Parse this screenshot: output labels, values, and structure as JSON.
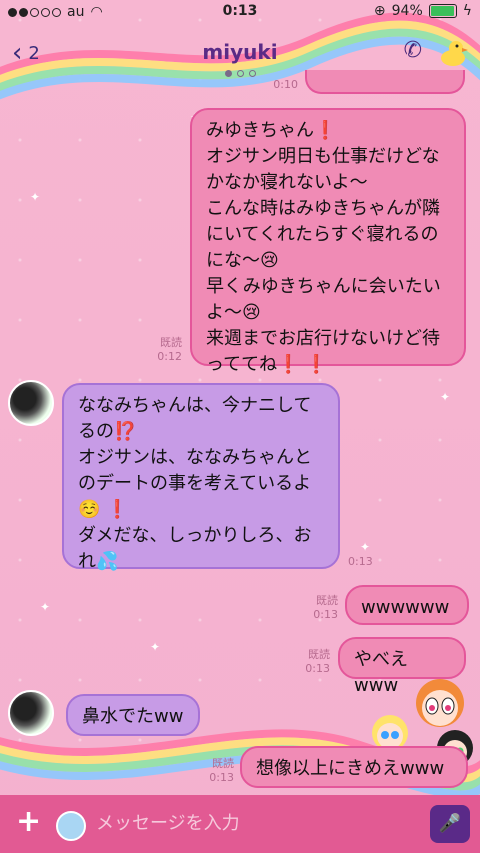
{
  "status_bar": {
    "carrier": "au",
    "time": "0:13",
    "battery": "94%"
  },
  "header": {
    "unread_count": "2",
    "title": "miyuki"
  },
  "messages": [
    {
      "id": "m0",
      "sender": "me",
      "time": "0:10"
    },
    {
      "id": "m1",
      "sender": "me",
      "text": "みゆきちゃん❗\nオジサン明日も仕事だけどな\nかなか寝れないよ〜\nこんな時はみゆきちゃんが隣\nにいてくれたらすぐ寝れるの\nにな〜😢\n早くみゆきちゃんに会いたい\nよ〜😢\n来週までお店行けないけど待\nっててね❗ ❗",
      "read": "既読",
      "time": "0:12"
    },
    {
      "id": "m2",
      "sender": "them",
      "text": "ななみちゃんは、今ナニして\nるの⁉️\nオジサンは、ななみちゃんと\nのデートの事を考えているよ\n☺️ ❗\nダメだな、しっかりしろ、お\nれ💦",
      "time": "0:13"
    },
    {
      "id": "m3",
      "sender": "me",
      "text": "wwwwww",
      "read": "既読",
      "time": "0:13"
    },
    {
      "id": "m4",
      "sender": "me",
      "text": "やべえwww",
      "read": "既読",
      "time": "0:13"
    },
    {
      "id": "m5",
      "sender": "them",
      "text": "鼻水でたww"
    },
    {
      "id": "m6",
      "sender": "me",
      "text": "想像以上にきめえwww",
      "read": "既読",
      "time": "0:13"
    }
  ],
  "input_bar": {
    "placeholder": "メッセージを入力"
  },
  "colors": {
    "background": "#f7b8d2",
    "my_bubble": "#f08bb5",
    "their_bubble": "#c79be6",
    "bottom_bar": "#e25a93"
  },
  "icons": [
    "back-chevron-icon",
    "phone-icon",
    "duck-icon",
    "plus-icon",
    "sticker-icon",
    "mic-icon"
  ]
}
